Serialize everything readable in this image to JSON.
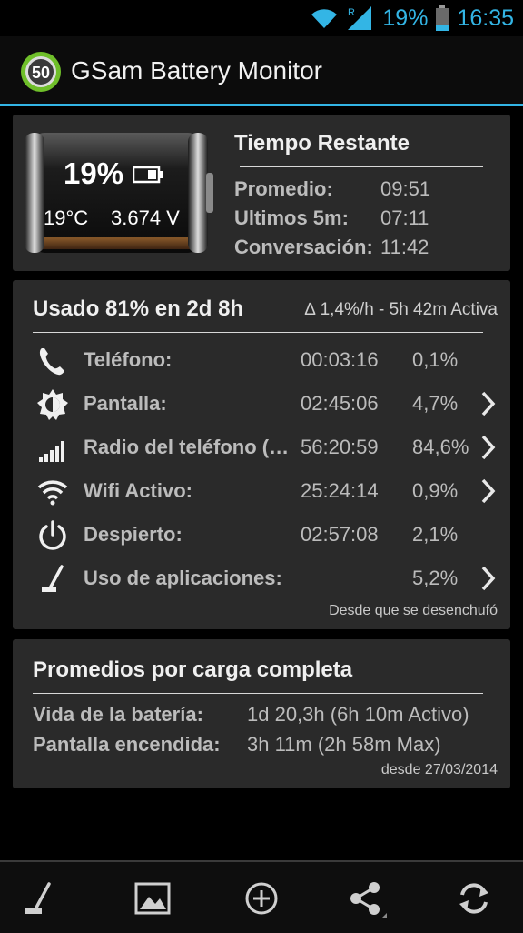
{
  "status_bar": {
    "battery_percent": "19%",
    "time": "16:35",
    "signal_badge": "R",
    "icons": [
      "wifi-icon",
      "signal-icon",
      "battery-icon"
    ]
  },
  "app_bar": {
    "logo_number": "50",
    "title": "GSam Battery Monitor",
    "accent_color": "#33b5e5"
  },
  "battery_card": {
    "percent": "19%",
    "temperature": "19°C",
    "voltage": "3.674 V",
    "level_fraction": 0.19,
    "remaining": {
      "title": "Tiempo Restante",
      "rows": [
        {
          "label": "Promedio:",
          "value": "09:51"
        },
        {
          "label": "Ultimos 5m:",
          "value": "07:11"
        },
        {
          "label": "Conversación:",
          "value": "11:42"
        }
      ]
    }
  },
  "usage_card": {
    "title": "Usado 81% en 2d 8h",
    "rate": "∆ 1,4%/h - 5h 42m Activa",
    "rows": [
      {
        "icon": "phone-icon",
        "label": "Teléfono:",
        "time": "00:03:16",
        "pct": "0,1%",
        "chevron": false
      },
      {
        "icon": "screen-brightness-icon",
        "label": "Pantalla:",
        "time": "02:45:06",
        "pct": "4,7%",
        "chevron": true
      },
      {
        "icon": "signal-bars-icon",
        "label": "Radio del teléfono (…",
        "time": "56:20:59",
        "pct": "84,6%",
        "chevron": true
      },
      {
        "icon": "wifi-icon",
        "label": "Wifi Activo:",
        "time": "25:24:14",
        "pct": "0,9%",
        "chevron": true
      },
      {
        "icon": "power-icon",
        "label": "Despierto:",
        "time": "02:57:08",
        "pct": "2,1%",
        "chevron": false
      },
      {
        "icon": "app-usage-icon",
        "label": "Uso de aplicaciones:",
        "time": "",
        "pct": "5,2%",
        "chevron": true
      }
    ],
    "footer": "Desde que se desenchufó"
  },
  "averages_card": {
    "title": "Promedios por carga completa",
    "rows": [
      {
        "label": "Vida de la batería:",
        "value": "1d 20,3h (6h 10m Activo)"
      },
      {
        "label": "Pantalla encendida:",
        "value": "3h 11m (2h 58m Max)"
      }
    ],
    "footer": "desde 27/03/2014"
  },
  "bottom_bar": {
    "buttons": [
      "app-usage-icon",
      "image-icon",
      "add-circle-icon",
      "share-icon",
      "refresh-icon"
    ]
  }
}
